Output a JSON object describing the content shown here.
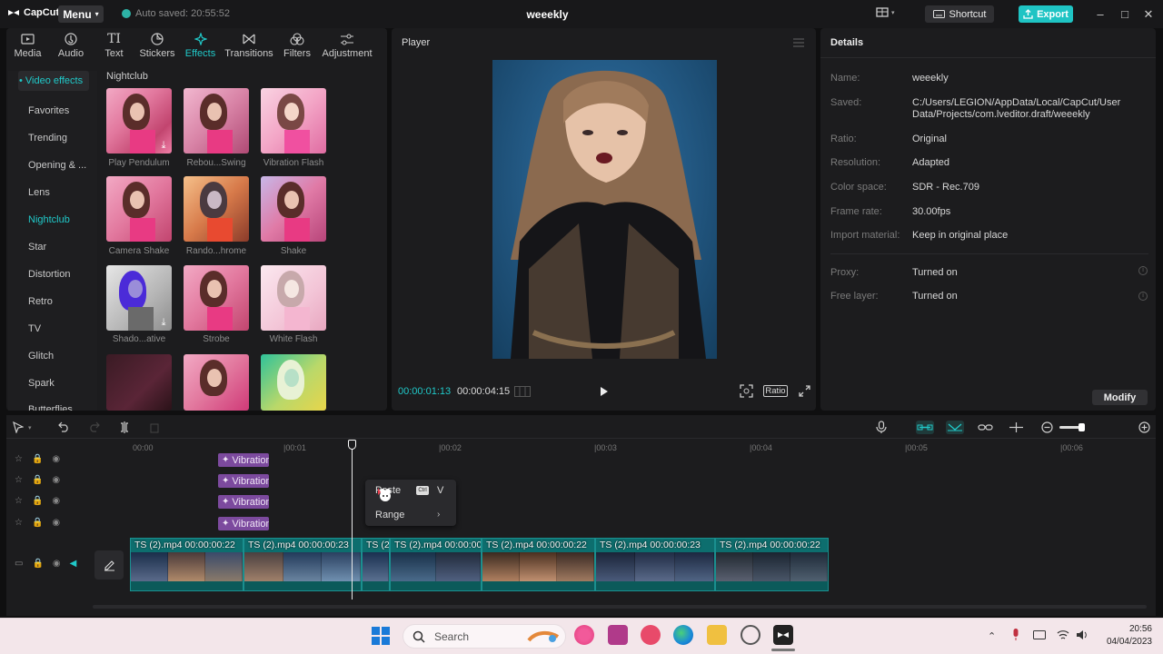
{
  "app": {
    "name": "CapCut",
    "menu_label": "Menu",
    "autosave": "Auto saved: 20:55:52",
    "project_title": "weeekly",
    "shortcut_label": "Shortcut",
    "export_label": "Export"
  },
  "tools": [
    {
      "label": "Media",
      "icon": "media-icon"
    },
    {
      "label": "Audio",
      "icon": "audio-icon"
    },
    {
      "label": "Text",
      "icon": "text-icon"
    },
    {
      "label": "Stickers",
      "icon": "stickers-icon"
    },
    {
      "label": "Effects",
      "icon": "effects-icon",
      "active": true
    },
    {
      "label": "Transitions",
      "icon": "transitions-icon"
    },
    {
      "label": "Filters",
      "icon": "filters-icon"
    },
    {
      "label": "Adjustment",
      "icon": "adjustment-icon"
    }
  ],
  "sidebar": {
    "header": "• Video effects",
    "items": [
      "Favorites",
      "Trending",
      "Opening & ...",
      "Lens",
      "Nightclub",
      "Star",
      "Distortion",
      "Retro",
      "TV",
      "Glitch",
      "Spark",
      "Butterflies"
    ],
    "active": "Nightclub"
  },
  "effects": {
    "category_title": "Nightclub",
    "items": [
      "Play Pendulum",
      "Rebou...Swing",
      "Vibration Flash",
      "Camera Shake",
      "Rando...hrome",
      "Shake",
      "Shado...ative",
      "Strobe",
      "White Flash",
      "",
      "",
      ""
    ]
  },
  "player": {
    "title": "Player",
    "current_time": "00:00:01:13",
    "total_time": "00:00:04:15",
    "ratio_label": "Ratio"
  },
  "details": {
    "title": "Details",
    "rows": [
      {
        "label": "Name:",
        "value": "weeekly"
      },
      {
        "label": "Saved:",
        "value": "C:/Users/LEGION/AppData/Local/CapCut/User Data/Projects/com.lveditor.draft/weeekly"
      },
      {
        "label": "Ratio:",
        "value": "Original"
      },
      {
        "label": "Resolution:",
        "value": "Adapted"
      },
      {
        "label": "Color space:",
        "value": "SDR - Rec.709"
      },
      {
        "label": "Frame rate:",
        "value": "30.00fps"
      },
      {
        "label": "Import material:",
        "value": "Keep in original place"
      },
      {
        "label": "Proxy:",
        "value": "Turned on"
      },
      {
        "label": "Free layer:",
        "value": "Turned on"
      }
    ],
    "modify_label": "Modify"
  },
  "timeline": {
    "ruler": [
      "00:00",
      "|00:01",
      "|00:02",
      "|00:03",
      "|00:04",
      "|00:05",
      "|00:06"
    ],
    "effect_clips": [
      "Vibration",
      "Vibration",
      "Vibration",
      "Vibration"
    ],
    "video_clips": [
      {
        "label": "TS (2).mp4   00:00:00:22"
      },
      {
        "label": "TS (2).mp4   00:00:00:23"
      },
      {
        "label": "TS (2"
      },
      {
        "label": "TS (2).mp4   00:00:00:1"
      },
      {
        "label": "TS (2).mp4   00:00:00:22"
      },
      {
        "label": "TS (2).mp4   00:00:00:23"
      },
      {
        "label": "TS (2).mp4   00:00:00:22"
      }
    ],
    "context_menu": {
      "paste_label": "Paste",
      "paste_shortcut_key": "Ctrl",
      "paste_shortcut_letter": "V",
      "range_label": "Range"
    }
  },
  "taskbar": {
    "search_label": "Search",
    "time": "20:56",
    "date": "04/04/2023"
  },
  "colors": {
    "accent": "#20c9c9",
    "effect_clip": "#7c4a9e",
    "video_clip": "#0d6e6e",
    "export": "#1fc4c4"
  }
}
